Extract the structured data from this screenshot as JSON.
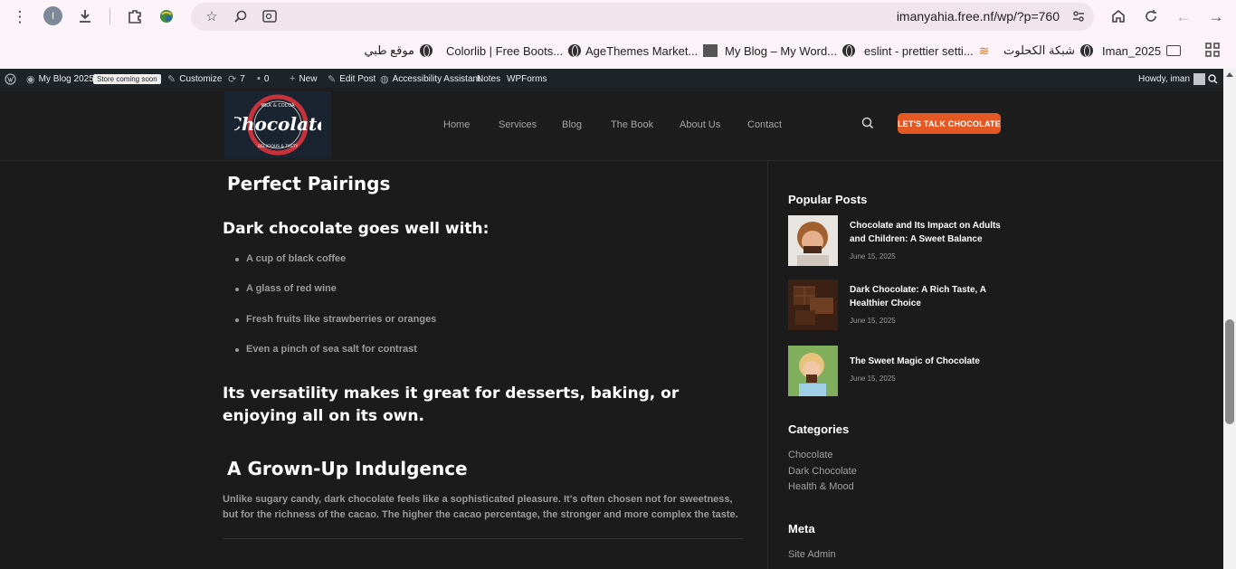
{
  "browser": {
    "url": "imanyahia.free.nf/wp/?p=760",
    "profile_initial": "I",
    "bookmarks": [
      {
        "label": "موقع طبي",
        "icon": "globe-icon"
      },
      {
        "label": "Colorlib | Free Boots...",
        "icon": "globe-icon"
      },
      {
        "label": "AgeThemes Market...",
        "icon": "agethemes-icon"
      },
      {
        "label": "My Blog – My Word...",
        "icon": "globe-icon"
      },
      {
        "label": "eslint - prettier setti...",
        "icon": "stackoverflow-icon"
      },
      {
        "label": "شبكة الكحلوت",
        "icon": "globe-icon"
      },
      {
        "label": "Iman_2025",
        "icon": "folder-icon"
      }
    ]
  },
  "admin_bar": {
    "site_name": "My Blog 2025",
    "store_badge": "Store coming soon",
    "customize": "Customize",
    "updates": "7",
    "comments": "0",
    "new": "New",
    "edit_post": "Edit Post",
    "accessibility": "Accessibility Assistant",
    "notes": "Notes",
    "wpforms": "WPForms",
    "howdy": "Howdy, iman"
  },
  "header": {
    "logo_text": "Chocolate",
    "logo_ring_top": "MILK & COCOA",
    "logo_ring_bottom": "DELICIOUS & TASTY",
    "nav": [
      "Home",
      "Services",
      "Blog",
      "The Book",
      "About Us",
      "Contact"
    ],
    "cta": "LET'S TALK CHOCOLATE"
  },
  "article": {
    "section1_title": "Perfect Pairings",
    "pairings_heading": "Dark chocolate goes well with:",
    "pairings": [
      "A cup of black coffee",
      "A glass of red wine",
      "Fresh fruits like strawberries or oranges",
      "Even a pinch of sea salt for contrast"
    ],
    "versatility": "Its versatility makes it great for desserts, baking, or enjoying all on its own.",
    "section2_title": "A Grown-Up Indulgence",
    "section2_text": "Unlike sugary candy, dark chocolate feels like a sophisticated pleasure. It's often chosen not for sweetness, but for the richness of the cacao. The higher the cacao percentage, the stronger and more complex the taste."
  },
  "sidebar": {
    "popular_title": "Popular Posts",
    "posts": [
      {
        "title": "Chocolate and Its Impact on Adults and Children: A Sweet Balance",
        "date": "June 15, 2025"
      },
      {
        "title": "Dark Chocolate: A Rich Taste, A Healthier Choice",
        "date": "June 15, 2025"
      },
      {
        "title": "The Sweet Magic of Chocolate",
        "date": "June 15, 2025"
      }
    ],
    "categories_title": "Categories",
    "categories": [
      "Chocolate",
      "Dark Chocolate",
      "Health & Mood"
    ],
    "meta_title": "Meta",
    "meta_links": [
      "Site Admin"
    ]
  }
}
